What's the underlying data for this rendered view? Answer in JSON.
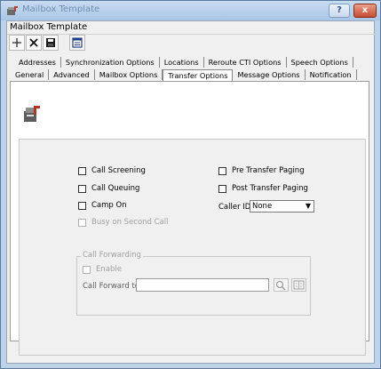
{
  "window": {
    "title": "Mailbox Template",
    "help_label": "?",
    "close_label": "x"
  },
  "document": {
    "title": "Mailbox Template"
  },
  "toolbar": {
    "items": [
      "add-icon",
      "delete-icon",
      "save-icon",
      "properties-icon"
    ]
  },
  "tabs": {
    "row1": [
      "Addresses",
      "Synchronization Options",
      "Locations",
      "Reroute CTI Options",
      "Speech Options"
    ],
    "row2": [
      "General",
      "Advanced",
      "Mailbox Options",
      "Transfer Options",
      "Message Options",
      "Notification"
    ],
    "active": "Transfer Options"
  },
  "options": {
    "call_screening": {
      "label": "Call Screening",
      "checked": false
    },
    "call_queuing": {
      "label": "Call Queuing",
      "checked": false
    },
    "camp_on": {
      "label": "Camp On",
      "checked": false
    },
    "busy_on_second_call": {
      "label": "Busy on Second Call",
      "checked": false,
      "disabled": true
    },
    "pre_transfer_paging": {
      "label": "Pre Transfer Paging",
      "checked": false
    },
    "post_transfer_paging": {
      "label": "Post Transfer Paging",
      "checked": false
    },
    "caller_id": {
      "label": "Caller ID",
      "value": "None"
    }
  },
  "call_forwarding": {
    "group_label": "Call Forwarding",
    "enable_label": "Enable",
    "forward_to_label": "Call Forward to",
    "forward_to_value": ""
  }
}
